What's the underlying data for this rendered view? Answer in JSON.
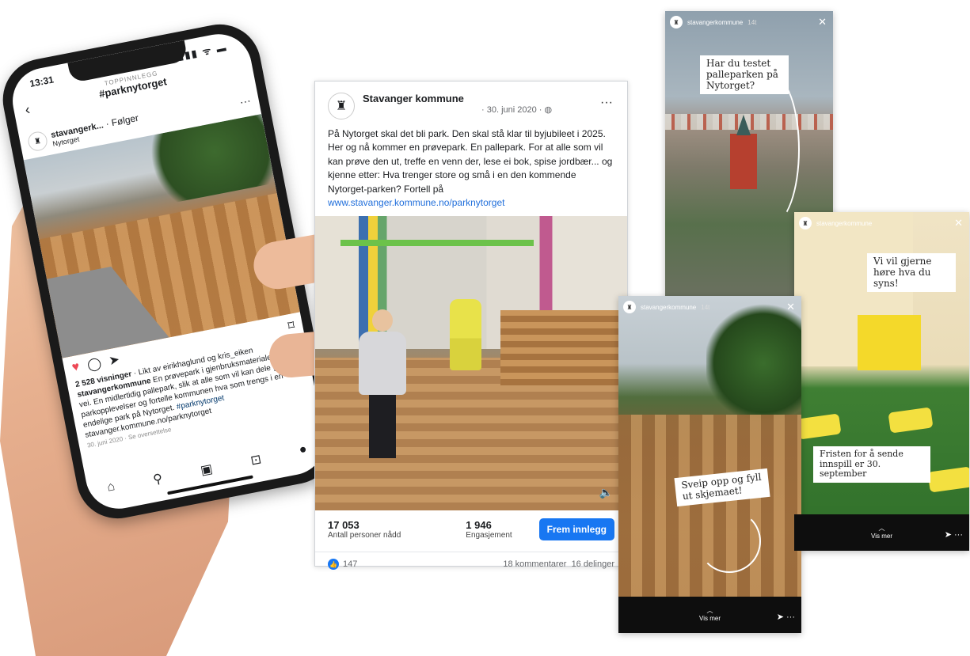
{
  "instagram": {
    "time": "13:31",
    "status_icons": "▮▮▮ ᯤ ▬",
    "header_small": "TOPPINNLEGG",
    "header_tag": "#parknytorget",
    "username": "stavangerk...",
    "follow": "· Følger",
    "location": "Nytorget",
    "views": "2 528 visninger",
    "liked_by": " · Likt av eirikhaglund og kris_eiken",
    "caption_user": "stavangerkommune",
    "caption": " En prøvepark i gjenbruksmaterialer er på vei. En midlertidig pallepark, slik at alle som vil kan dele gode parkopplevelser og fortelle kommunen hva som trengs i en endelige park på Nytorget. ",
    "caption_tag": "#parknytorget",
    "caption_link": "stavanger.kommune.no/parknytorget",
    "date": "30. juni 2020",
    "translate": "Se oversettelse"
  },
  "facebook": {
    "page_name": "Stavanger kommune",
    "date": "· 30. juni 2020 · ",
    "post_text": "På Nytorget skal det bli park. Den skal stå klar til byjubileet i 2025. Her og nå kommer en prøvepark. En pallepark. For at alle som vil kan prøve den ut, treffe en venn der, lese ei bok, spise jordbær... og kjenne etter: Hva trenger store og små i en den kommende Nytorget-parken? Fortell på",
    "post_url": "www.stavanger.kommune.no/parknytorget",
    "reach_num": "17 053",
    "reach_label": "Antall personer nådd",
    "engagement_num": "1 946",
    "engagement_label": "Engasjement",
    "boost_label": "Frem innlegg",
    "likes": "147",
    "comments": "18 kommentarer",
    "shares": "16 delinger"
  },
  "stories": {
    "account": "stavangerkommune",
    "age": "14t",
    "story1_callout": "Har du testet palleparken på Nytorget?",
    "story2_callout_top": "Vi vil gjerne høre hva du syns!",
    "story2_callout_bottom": "Fristen for å sende innspill er 30. september",
    "story3_callout": "Sveip opp og fyll ut skjemaet!",
    "see_more": "Vis mer"
  }
}
